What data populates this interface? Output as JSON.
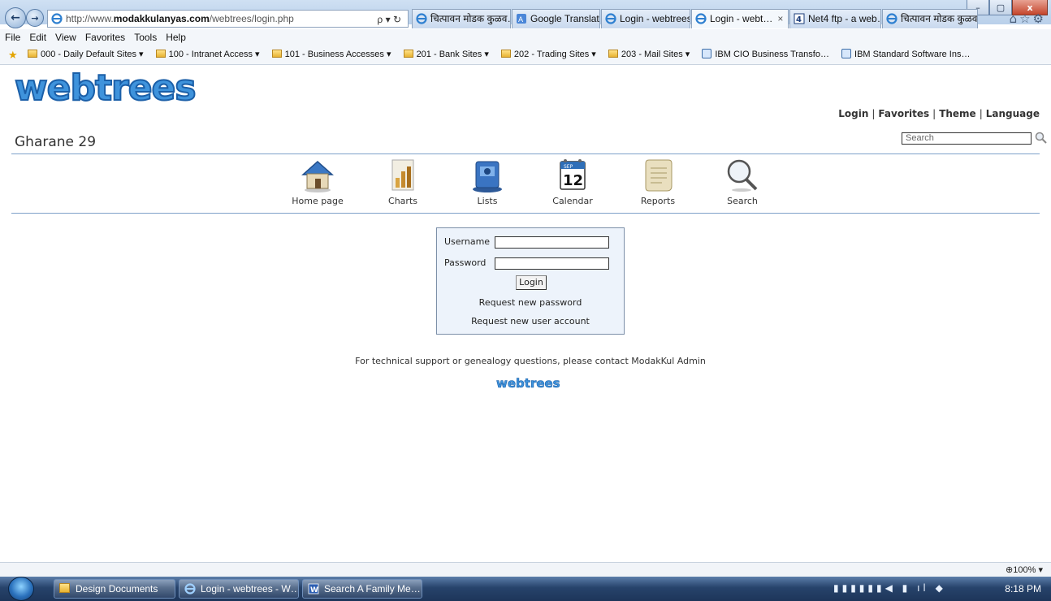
{
  "browser": {
    "address_prefix": "http://www.",
    "address_domain": "modakkulanyas.com",
    "address_path": "/webtrees/login.php",
    "address_tools": "ρ ▾ ↻",
    "tabs": [
      {
        "label": "चित्पावन मोडक कुळव…",
        "icon": "ie-icon"
      },
      {
        "label": "Google Translate",
        "icon": "translate-icon"
      },
      {
        "label": "Login - webtrees",
        "icon": "ie-icon"
      },
      {
        "label": "Login - webt…",
        "icon": "ie-icon",
        "active": true
      },
      {
        "label": "Net4 ftp - a web…",
        "icon": "net4-icon"
      },
      {
        "label": "चित्पावन मोडक कुळव…",
        "icon": "ie-icon"
      }
    ],
    "tab_close": "×",
    "toolbar_icons": "⌂☆⚙",
    "menu": [
      "File",
      "Edit",
      "View",
      "Favorites",
      "Tools",
      "Help"
    ],
    "favorites": [
      {
        "label": "000 - Daily Default Sites ▾",
        "type": "folder"
      },
      {
        "label": "100 - Intranet Access ▾",
        "type": "folder"
      },
      {
        "label": "101 - Business Accesses ▾",
        "type": "folder"
      },
      {
        "label": "201 - Bank Sites ▾",
        "type": "folder"
      },
      {
        "label": "202 - Trading Sites ▾",
        "type": "folder"
      },
      {
        "label": "203 - Mail Sites ▾",
        "type": "folder"
      },
      {
        "label": "IBM CIO Business Transfo…",
        "type": "page"
      },
      {
        "label": "IBM Standard Software Ins…",
        "type": "page"
      }
    ],
    "window_controls": {
      "minimize": "–",
      "maximize": "▢",
      "close": "x"
    },
    "zoom": "100%",
    "zoom_caret": "▾"
  },
  "site": {
    "logo_text": "webtrees",
    "name": "Gharane 29",
    "toplinks": [
      "Login",
      "Favorites",
      "Theme",
      "Language"
    ],
    "toplink_separator": "|",
    "search_placeholder": "Search"
  },
  "nav": [
    {
      "label": "Home page",
      "icon": "home-icon"
    },
    {
      "label": "Charts",
      "icon": "charts-icon"
    },
    {
      "label": "Lists",
      "icon": "lists-icon"
    },
    {
      "label": "Calendar",
      "icon": "calendar-icon",
      "day": "12",
      "month": "SEP"
    },
    {
      "label": "Reports",
      "icon": "reports-icon"
    },
    {
      "label": "Search",
      "icon": "search-icon"
    }
  ],
  "login": {
    "username_label": "Username",
    "password_label": "Password",
    "username_value": "",
    "password_value": "",
    "button": "Login",
    "request_password": "Request new password",
    "request_account": "Request new user account"
  },
  "footer": {
    "support_text": "For technical support or genealogy questions, please contact ModakKul Admin",
    "small_logo_text": "webtrees"
  },
  "taskbar": {
    "tasks": [
      {
        "label": "Design Documents",
        "icon": "folder-icon"
      },
      {
        "label": "Login - webtrees - W…",
        "icon": "ie-icon"
      },
      {
        "label": "Search A Family Me…",
        "icon": "word-icon"
      }
    ],
    "tray_icons": "▮▮▮▮▮▮◀ ▮ ıl ◆",
    "clock": "8:18 PM"
  },
  "colors": {
    "accent": "#7ea1c9",
    "logo_blue": "#2f87d6",
    "login_box_bg": "#edf3fb"
  }
}
